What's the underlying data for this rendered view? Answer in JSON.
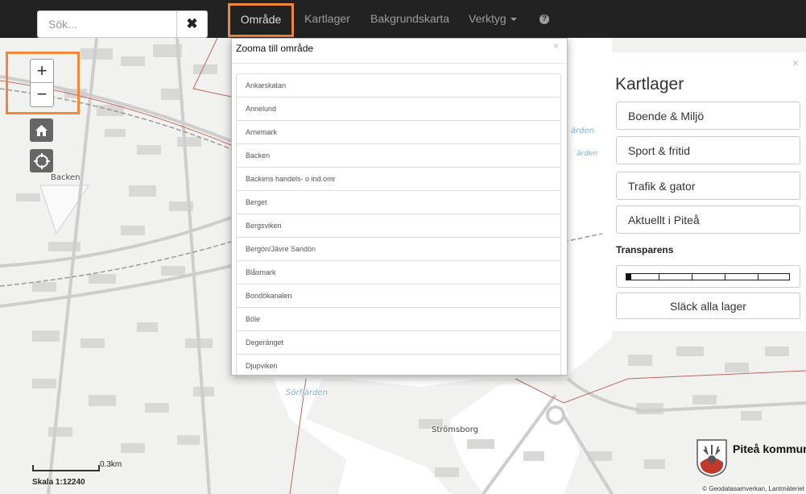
{
  "navbar": {
    "search_placeholder": "Sök...",
    "items": [
      {
        "label": "Område"
      },
      {
        "label": "Kartlager"
      },
      {
        "label": "Bakgrundskarta"
      },
      {
        "label": "Verktyg"
      }
    ],
    "help_icon": "question-circle-icon",
    "clear_icon": "close-icon"
  },
  "map_controls": {
    "zoom_in": "+",
    "zoom_out": "−",
    "home_icon": "home-icon",
    "locate_icon": "crosshair-icon"
  },
  "area_panel": {
    "title": "Zooma till område",
    "close": "×",
    "items": [
      "Ankarskatan",
      "Annelund",
      "Arnemark",
      "Backen",
      "Backens handels- o ind.omr",
      "Berget",
      "Bergsviken",
      "Bergön/Jävre Sandön",
      "Blåsmark",
      "Bondökanalen",
      "Böle",
      "Degeränget",
      "Djupviken"
    ]
  },
  "layers_panel": {
    "title": "Kartlager",
    "close": "×",
    "layers": [
      "Boende & Miljö",
      "Sport & fritid",
      "Trafik & gator",
      "Aktuellt i Piteå"
    ],
    "transparency_label": "Transparens",
    "transparency_value": 0.0,
    "clear_button": "Släck alla lager"
  },
  "map": {
    "labels": {
      "backen": "Backen",
      "sorfjarden": "Sörfjärden",
      "stromsborg": "Strömsborg",
      "arden": "ärden",
      "arden2": "ärden"
    },
    "colors": {
      "water": "#ffffff",
      "land": "#f1f1ef",
      "road": "#cfcfcf",
      "building": "#d6d6d6",
      "rail": "#999999",
      "boundary": "#c0665d"
    }
  },
  "scale": {
    "distance": "0.3km",
    "text": "Skala 1:12240"
  },
  "logo": {
    "text": "Piteå kommun"
  },
  "attribution": "© Geodatasamverkan, Lantmäteriet"
}
